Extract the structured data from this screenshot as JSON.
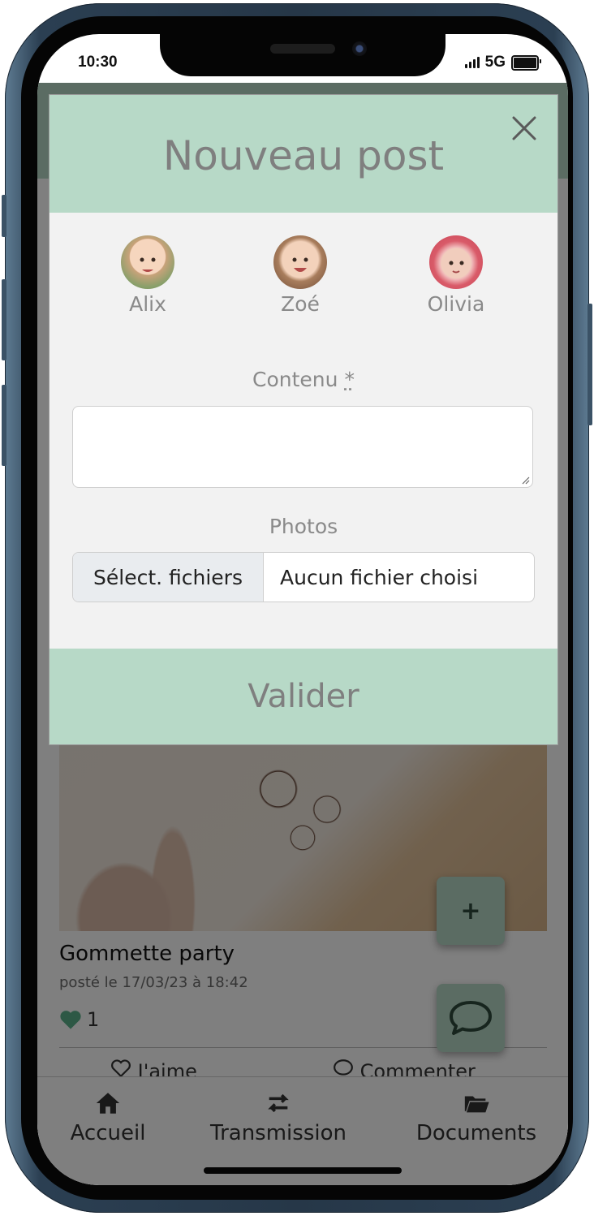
{
  "status_bar": {
    "time": "10:30",
    "network": "5G"
  },
  "modal": {
    "title": "Nouveau post",
    "children": [
      {
        "name": "Alix",
        "color": "#e8c79f"
      },
      {
        "name": "Zoé",
        "color": "#e9c2a6"
      },
      {
        "name": "Olivia",
        "color": "#d95b69"
      }
    ],
    "content_label": "Contenu",
    "required_marker": "*",
    "content_value": "",
    "photos_label": "Photos",
    "file_button_label": "Sélect. fichiers",
    "file_status": "Aucun fichier choisi",
    "submit_label": "Valider"
  },
  "feed": {
    "post_title": "Gommette party",
    "post_date": "posté le 17/03/23 à 18:42",
    "likes_count": "1",
    "like_label": "J'aime",
    "comment_label": "Commenter"
  },
  "fabs": {
    "add_label": "+"
  },
  "bottom_nav": {
    "items": [
      {
        "label": "Accueil",
        "icon": "home-icon"
      },
      {
        "label": "Transmission",
        "icon": "transfer-icon"
      },
      {
        "label": "Documents",
        "icon": "folder-icon"
      }
    ]
  },
  "colors": {
    "accent": "#b7d9c7",
    "like": "#5bb08a",
    "overlay": "rgba(0,0,0,0.5)"
  }
}
